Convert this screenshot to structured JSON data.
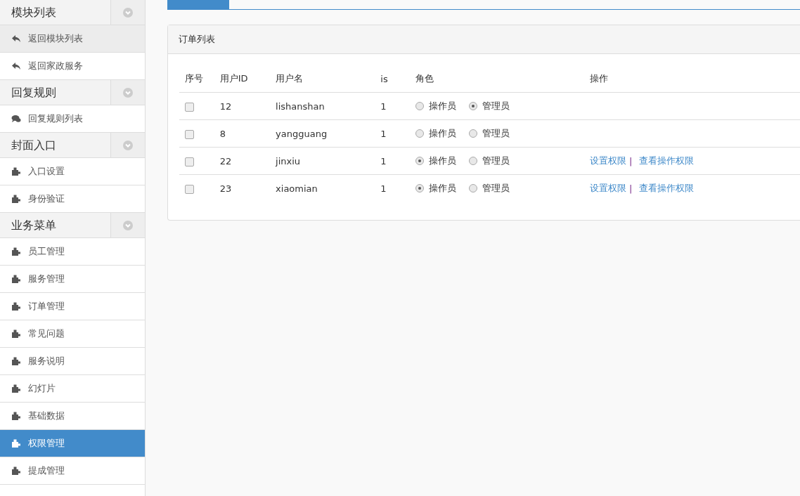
{
  "sidebar": {
    "groups": [
      {
        "title": "模块列表",
        "items": [
          {
            "label": "返回模块列表",
            "kind": "reply",
            "hovered": true,
            "selected": false
          },
          {
            "label": "返回家政服务",
            "kind": "reply",
            "hovered": false,
            "selected": false
          }
        ]
      },
      {
        "title": "回复规则",
        "items": [
          {
            "label": "回复规则列表",
            "kind": "comments",
            "hovered": false,
            "selected": false
          }
        ]
      },
      {
        "title": "封面入口",
        "items": [
          {
            "label": "入口设置",
            "kind": "puzzle",
            "hovered": false,
            "selected": false
          },
          {
            "label": "身份验证",
            "kind": "puzzle",
            "hovered": false,
            "selected": false
          }
        ]
      },
      {
        "title": "业务菜单",
        "items": [
          {
            "label": "员工管理",
            "kind": "puzzle",
            "hovered": false,
            "selected": false
          },
          {
            "label": "服务管理",
            "kind": "puzzle",
            "hovered": false,
            "selected": false
          },
          {
            "label": "订单管理",
            "kind": "puzzle",
            "hovered": false,
            "selected": false
          },
          {
            "label": "常见问题",
            "kind": "puzzle",
            "hovered": false,
            "selected": false
          },
          {
            "label": "服务说明",
            "kind": "puzzle",
            "hovered": false,
            "selected": false
          },
          {
            "label": "幻灯片",
            "kind": "puzzle",
            "hovered": false,
            "selected": false
          },
          {
            "label": "基础数据",
            "kind": "puzzle",
            "hovered": false,
            "selected": false
          },
          {
            "label": "权限管理",
            "kind": "puzzle",
            "hovered": false,
            "selected": true
          },
          {
            "label": "提成管理",
            "kind": "puzzle",
            "hovered": false,
            "selected": false
          }
        ]
      }
    ]
  },
  "panel": {
    "title": "订单列表",
    "table": {
      "columns": [
        "序号",
        "用户ID",
        "用户名",
        "is",
        "角色",
        "操作"
      ],
      "rows": [
        {
          "checked": false,
          "id": "12",
          "name": "lishanshan",
          "is": "1",
          "roles": [
            {
              "label": "操作员",
              "selected": false
            },
            {
              "label": "管理员",
              "selected": true
            }
          ],
          "actions": []
        },
        {
          "checked": false,
          "id": "8",
          "name": "yangguang",
          "is": "1",
          "roles": [
            {
              "label": "操作员",
              "selected": false
            },
            {
              "label": "管理员",
              "selected": false
            }
          ],
          "actions": []
        },
        {
          "checked": false,
          "id": "22",
          "name": "jinxiu",
          "is": "1",
          "roles": [
            {
              "label": "操作员",
              "selected": true
            },
            {
              "label": "管理员",
              "selected": false
            }
          ],
          "actions": [
            {
              "label": "设置权限",
              "separator": "|"
            },
            {
              "label": "查看操作权限"
            }
          ]
        },
        {
          "checked": false,
          "id": "23",
          "name": "xiaomian",
          "is": "1",
          "roles": [
            {
              "label": "操作员",
              "selected": true
            },
            {
              "label": "管理员",
              "selected": false
            }
          ],
          "actions": [
            {
              "label": "设置权限",
              "separator": "|"
            },
            {
              "label": "查看操作权限"
            }
          ]
        }
      ]
    }
  }
}
